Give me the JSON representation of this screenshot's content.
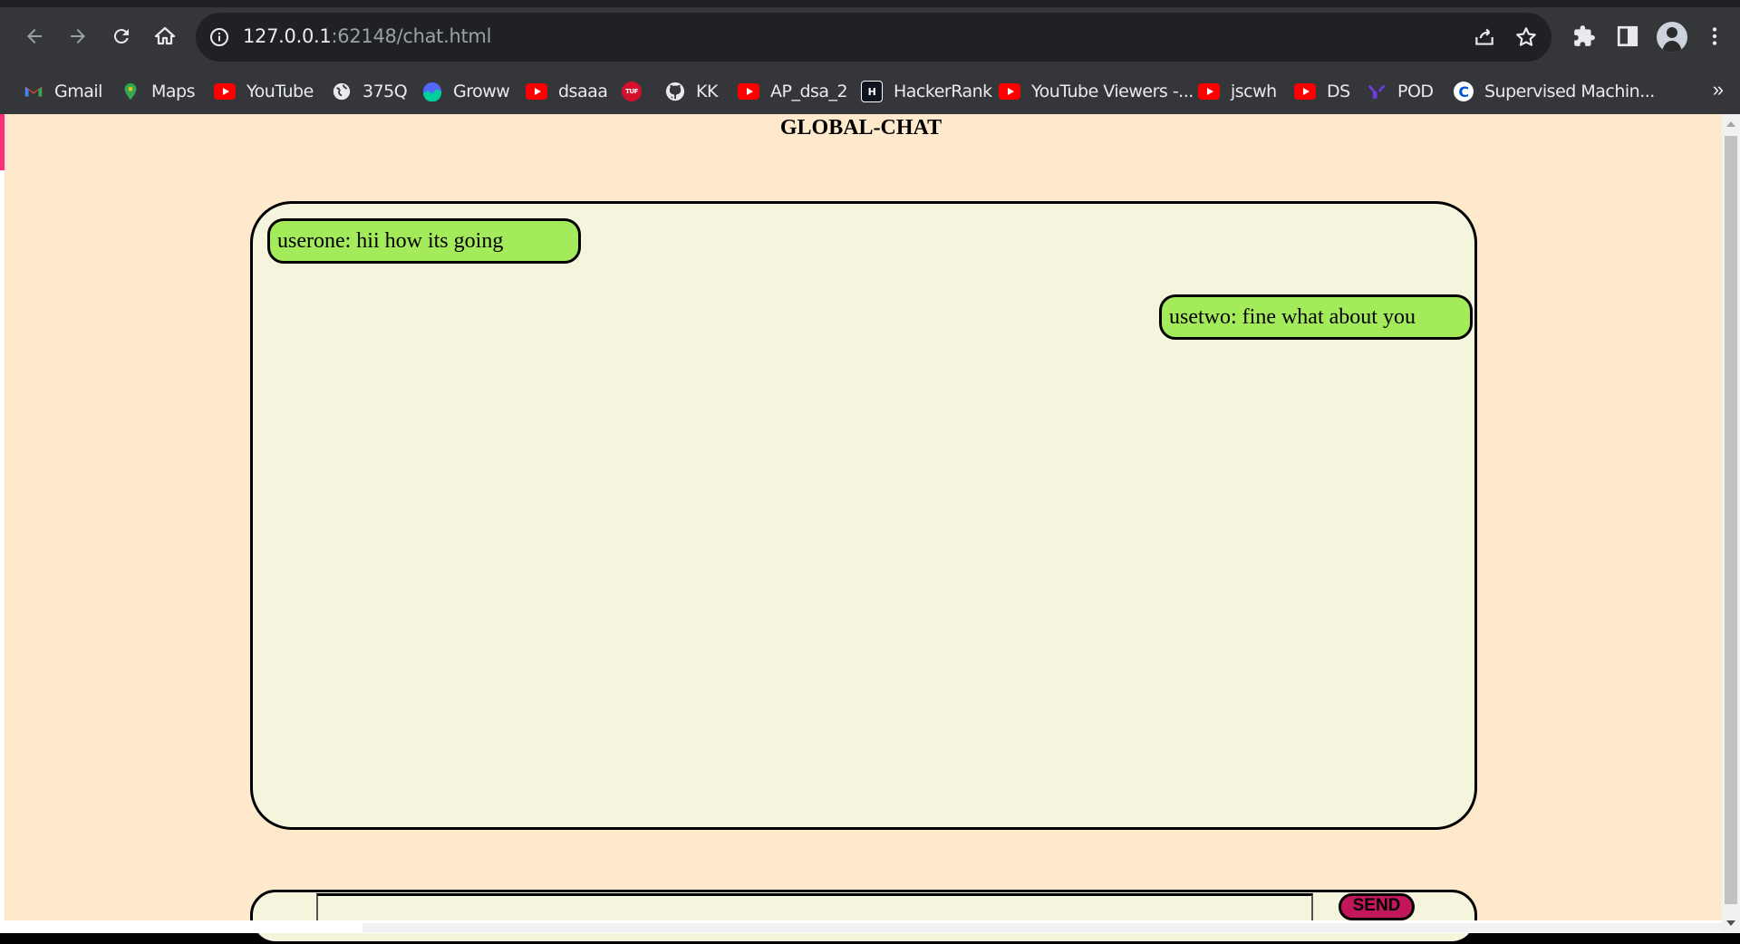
{
  "browser": {
    "url_host": "127.0.0.1",
    "url_path": ":62148/chat.html",
    "bookmarks": [
      {
        "label": "Gmail",
        "icon": "gmail-icon"
      },
      {
        "label": "Maps",
        "icon": "maps-icon"
      },
      {
        "label": "YouTube",
        "icon": "youtube-icon"
      },
      {
        "label": "375Q",
        "icon": "globe-icon"
      },
      {
        "label": "Groww",
        "icon": "groww-icon"
      },
      {
        "label": "dsaaa",
        "icon": "youtube-icon"
      },
      {
        "label": "",
        "icon": "tuf-icon"
      },
      {
        "label": "KK",
        "icon": "github-icon"
      },
      {
        "label": "AP_dsa_2",
        "icon": "youtube-icon"
      },
      {
        "label": "HackerRank",
        "icon": "hackerrank-icon"
      },
      {
        "label": "YouTube Viewers -...",
        "icon": "youtube-icon"
      },
      {
        "label": "jscwh",
        "icon": "youtube-icon"
      },
      {
        "label": "DS",
        "icon": "youtube-icon"
      },
      {
        "label": "POD",
        "icon": "pod-icon"
      },
      {
        "label": "Supervised Machin...",
        "icon": "coursera-icon"
      }
    ],
    "more_bookmarks_label": "»"
  },
  "page": {
    "title": "GLOBAL-CHAT",
    "messages": [
      {
        "text": "userone: hii how its going",
        "side": "left"
      },
      {
        "text": "usetwo: fine what about you",
        "side": "right"
      }
    ],
    "input": {
      "value": "",
      "placeholder": ""
    },
    "send_label": "SEND"
  },
  "colors": {
    "page_background": "#ffe9cc",
    "chat_background": "#f5f4dc",
    "message_bubble": "#a3eb5a",
    "send_button": "#c2185b"
  }
}
